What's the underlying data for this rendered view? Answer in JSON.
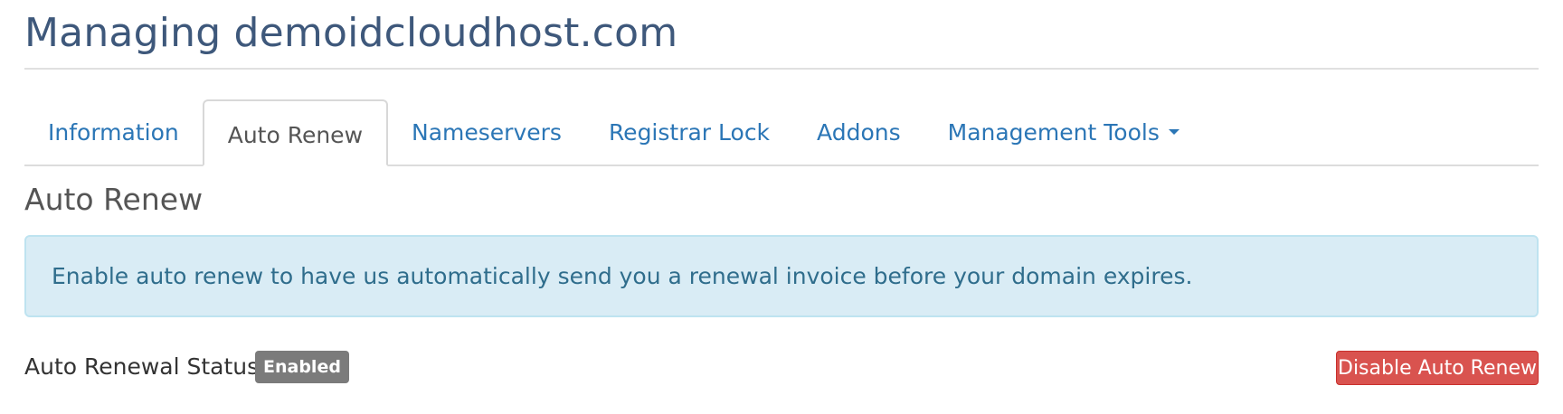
{
  "page": {
    "title": "Managing demoidcloudhost.com"
  },
  "tabs": [
    {
      "label": "Information",
      "active": false
    },
    {
      "label": "Auto Renew",
      "active": true
    },
    {
      "label": "Nameservers",
      "active": false
    },
    {
      "label": "Registrar Lock",
      "active": false
    },
    {
      "label": "Addons",
      "active": false
    },
    {
      "label": "Management Tools",
      "active": false,
      "icon": "caret-down-icon"
    }
  ],
  "section": {
    "title": "Auto Renew",
    "info_message": "Enable auto renew to have us automatically send you a renewal invoice before your domain expires.",
    "status_label": "Auto Renewal Status:",
    "status_badge": "Enabled",
    "action_button": "Disable Auto Renew"
  },
  "colors": {
    "title": "#3e587b",
    "link": "#2b76b6",
    "alert_bg": "#d9ecf5",
    "alert_text": "#2f6d8c",
    "badge_bg": "#7b7b7b",
    "danger": "#d9534f"
  }
}
